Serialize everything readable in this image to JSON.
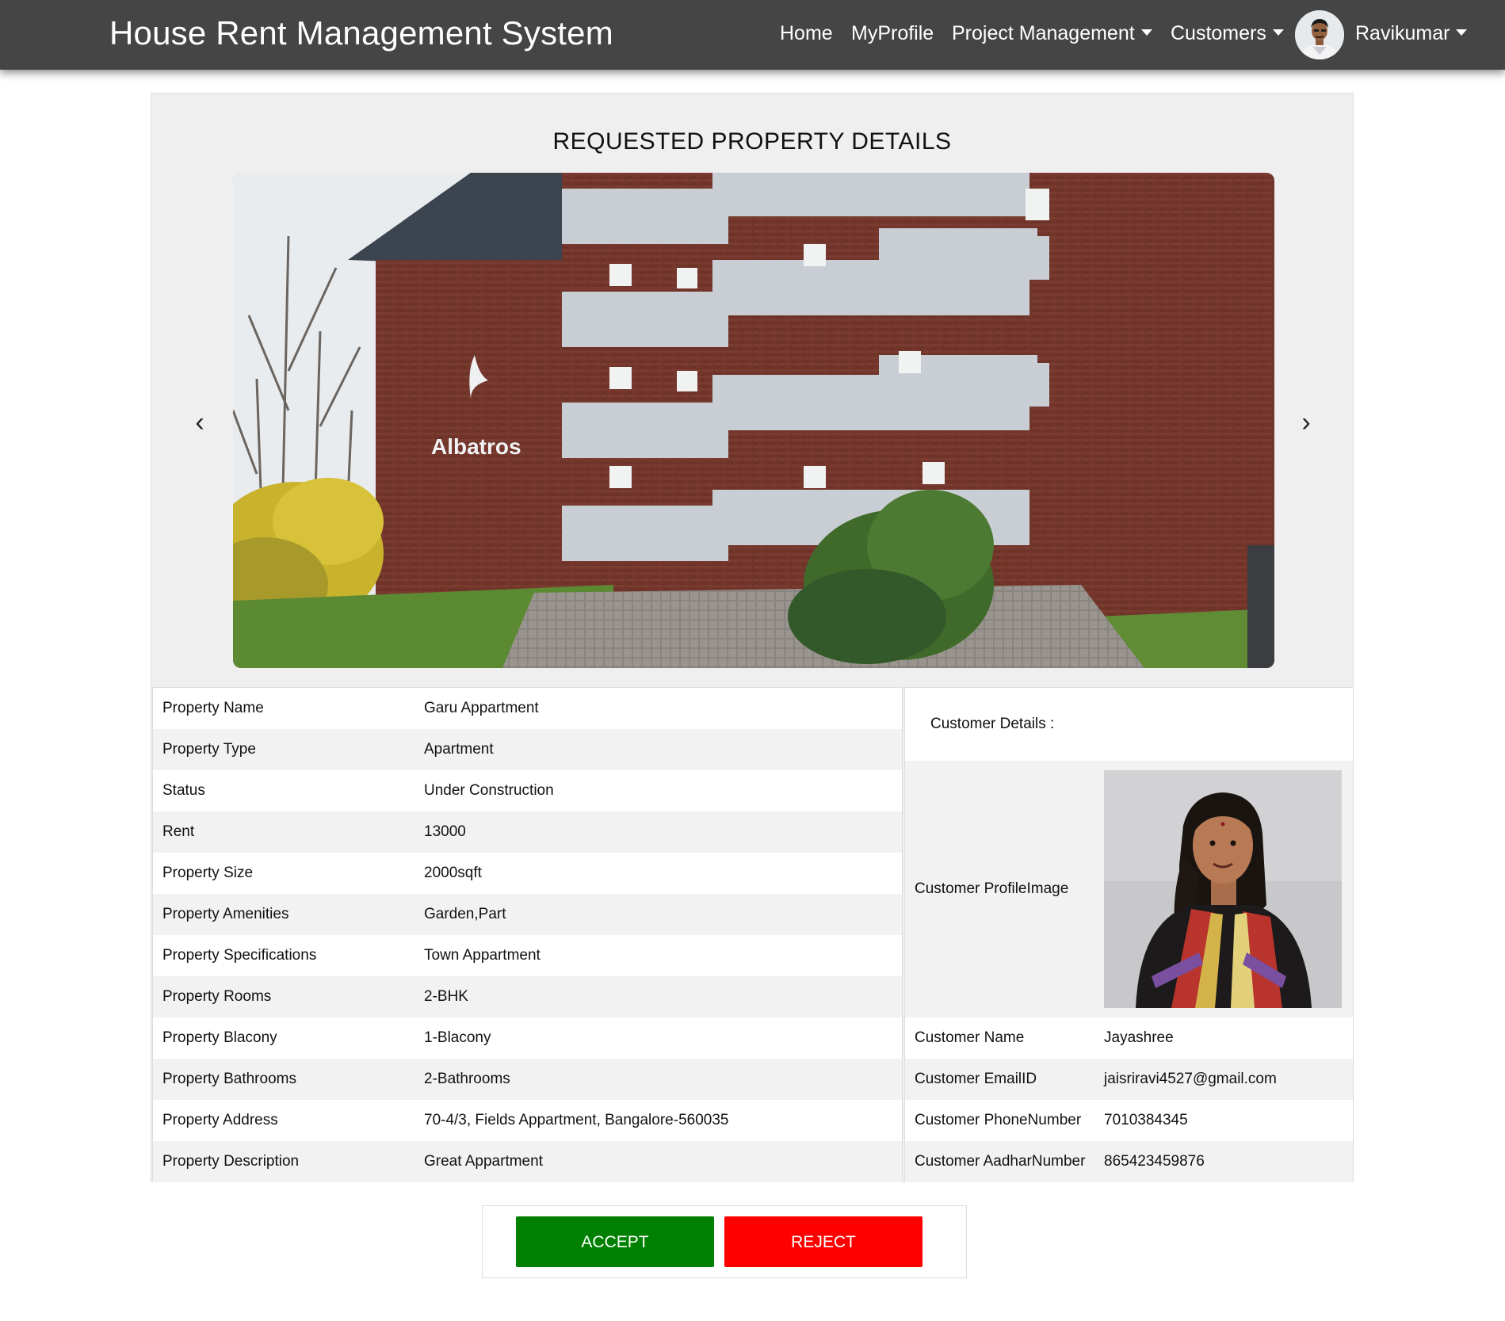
{
  "app": {
    "title": "House Rent Management System"
  },
  "nav": {
    "home": "Home",
    "profile": "MyProfile",
    "project_management": "Project Management",
    "customers": "Customers",
    "user_name": "Ravikumar"
  },
  "page": {
    "title": "REQUESTED PROPERTY DETAILS"
  },
  "carousel": {
    "prev": "‹",
    "next": "›",
    "sign_text": "Albatros"
  },
  "property": [
    {
      "label": "Property Name",
      "value": "Garu Appartment"
    },
    {
      "label": "Property Type",
      "value": "Apartment"
    },
    {
      "label": "Status",
      "value": "Under Construction"
    },
    {
      "label": "Rent",
      "value": "13000"
    },
    {
      "label": "Property Size",
      "value": "2000sqft"
    },
    {
      "label": "Property Amenities",
      "value": "Garden,Part"
    },
    {
      "label": "Property Specifications",
      "value": "Town Appartment"
    },
    {
      "label": "Property Rooms",
      "value": "2-BHK"
    },
    {
      "label": "Property Blacony",
      "value": "1-Blacony"
    },
    {
      "label": "Property Bathrooms",
      "value": "2-Bathrooms"
    },
    {
      "label": "Property Address",
      "value": "70-4/3, Fields Appartment, Bangalore-560035"
    },
    {
      "label": "Property Description",
      "value": "Great Appartment"
    }
  ],
  "customer": {
    "heading": "Customer Details :",
    "image_label": "Customer ProfileImage",
    "rows": [
      {
        "label": "Customer Name",
        "value": "Jayashree"
      },
      {
        "label": "Customer EmailID",
        "value": "jaisriravi4527@gmail.com"
      },
      {
        "label": "Customer PhoneNumber",
        "value": "7010384345"
      },
      {
        "label": "Customer AadharNumber",
        "value": "865423459876"
      }
    ]
  },
  "actions": {
    "accept": "ACCEPT",
    "reject": "REJECT"
  },
  "colors": {
    "navbar": "#454545",
    "panel": "#efefef",
    "accept": "#008000",
    "reject": "#ff0000"
  }
}
